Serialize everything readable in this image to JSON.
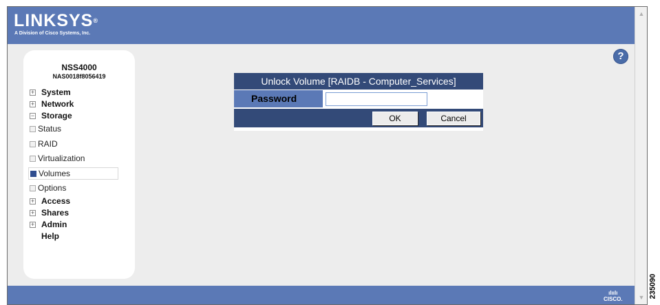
{
  "header": {
    "brand": "LINKSYS",
    "registered_mark": "®",
    "tagline": "A Division of Cisco Systems, Inc."
  },
  "sidebar": {
    "device_model": "NSS4000",
    "device_id": "NAS0018f8056419",
    "items": [
      {
        "label": "System",
        "expander": "+"
      },
      {
        "label": "Network",
        "expander": "+"
      },
      {
        "label": "Storage",
        "expander": "−"
      },
      {
        "label": "Access",
        "expander": "+"
      },
      {
        "label": "Shares",
        "expander": "+"
      },
      {
        "label": "Admin",
        "expander": "+"
      },
      {
        "label": "Help"
      }
    ],
    "storage_subitems": [
      {
        "label": "Status"
      },
      {
        "label": "RAID"
      },
      {
        "label": "Virtualization"
      },
      {
        "label": "Volumes",
        "selected": true
      },
      {
        "label": "Options"
      }
    ]
  },
  "help": {
    "glyph": "?",
    "icon": "help-question-icon"
  },
  "dialog": {
    "title": "Unlock Volume [RAIDB - Computer_Services]",
    "password_label": "Password",
    "password_value": "",
    "ok_label": "OK",
    "cancel_label": "Cancel"
  },
  "footer": {
    "cisco_bars": "ılıılı",
    "cisco_text": "CISCO."
  },
  "figure_number": "235090",
  "colors": {
    "header_blue": "#5b79b6",
    "dialog_navy": "#334a78",
    "selected_square": "#2f4d8f"
  }
}
